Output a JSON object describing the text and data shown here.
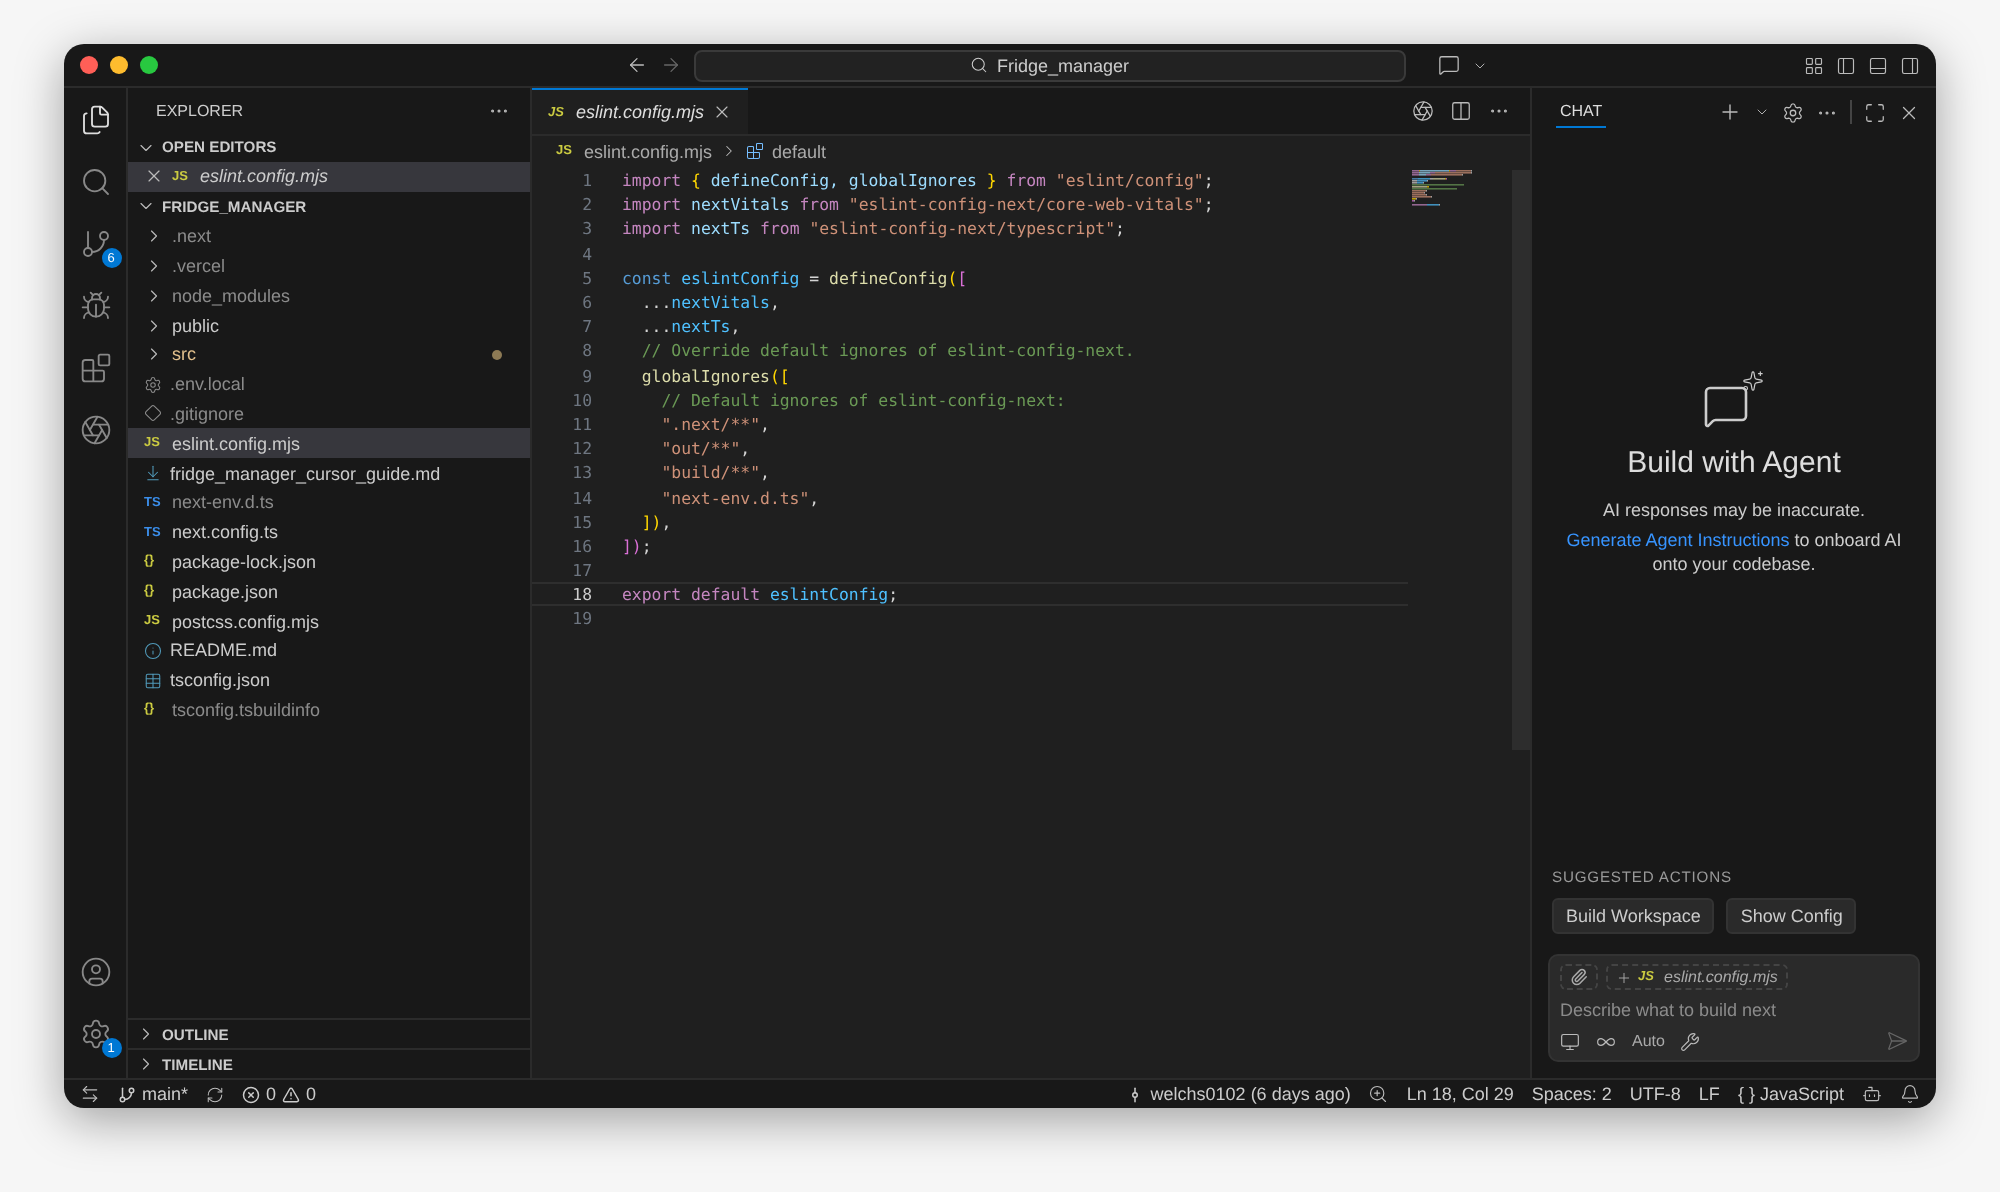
{
  "titlebar": {
    "search": "Fridge_manager"
  },
  "activity_bar": {
    "source_control_badge": "6",
    "settings_badge": "1"
  },
  "sidebar": {
    "title": "EXPLORER",
    "sections": [
      {
        "label": "OPEN EDITORS",
        "expanded": true,
        "items": [
          {
            "kind": "js",
            "label": "eslint.config.mjs",
            "badge": "JS",
            "selected": true
          }
        ]
      },
      {
        "label": "FRIDGE_MANAGER",
        "expanded": true,
        "items": [
          {
            "kind": "folder",
            "label": ".next",
            "expanded": false,
            "dimmed": true,
            "modified": false,
            "selected": false
          },
          {
            "kind": "folder",
            "label": ".vercel",
            "expanded": false,
            "dimmed": true,
            "modified": false,
            "selected": false
          },
          {
            "kind": "folder",
            "label": "node_modules",
            "expanded": false,
            "dimmed": true,
            "modified": false,
            "selected": false
          },
          {
            "kind": "folder",
            "label": "public",
            "expanded": false,
            "dimmed": false,
            "modified": false,
            "selected": false
          },
          {
            "kind": "folder",
            "label": "src",
            "expanded": false,
            "dimmed": false,
            "modified": true,
            "selected": false
          },
          {
            "kind": "env",
            "label": ".env.local",
            "dimmed": true,
            "modified": false,
            "selected": false
          },
          {
            "kind": "ignore",
            "label": ".gitignore",
            "dimmed": true,
            "modified": false,
            "selected": false
          },
          {
            "kind": "js",
            "badge": "JS",
            "label": "eslint.config.mjs",
            "dimmed": false,
            "modified": false,
            "selected": true
          },
          {
            "kind": "markdown",
            "label": "fridge_manager_cursor_guide.md",
            "dimmed": false,
            "modified": false,
            "selected": false
          },
          {
            "kind": "ts",
            "badge": "TS",
            "label": "next-env.d.ts",
            "dimmed": true,
            "modified": false,
            "selected": false
          },
          {
            "kind": "ts",
            "badge": "TS",
            "label": "next.config.ts",
            "dimmed": false,
            "modified": false,
            "selected": false
          },
          {
            "kind": "json",
            "badge": "{}",
            "label": "package-lock.json",
            "dimmed": false,
            "modified": false,
            "selected": false
          },
          {
            "kind": "json",
            "badge": "{}",
            "label": "package.json",
            "dimmed": false,
            "modified": false,
            "selected": false
          },
          {
            "kind": "js",
            "badge": "JS",
            "label": "postcss.config.mjs",
            "dimmed": false,
            "modified": false,
            "selected": false
          },
          {
            "kind": "readme",
            "label": "README.md",
            "dimmed": false,
            "modified": false,
            "selected": false
          },
          {
            "kind": "tsconfig",
            "label": "tsconfig.json",
            "dimmed": false,
            "modified": false,
            "selected": false
          },
          {
            "kind": "json",
            "badge": "{}",
            "label": "tsconfig.tsbuildinfo",
            "dimmed": true,
            "modified": false,
            "selected": false
          }
        ]
      }
    ],
    "bottom_sections": [
      {
        "label": "OUTLINE",
        "expanded": false
      },
      {
        "label": "TIMELINE",
        "expanded": false
      }
    ]
  },
  "editor": {
    "tabs": [
      {
        "badge": "JS",
        "label": "eslint.config.mjs",
        "selected": true
      }
    ],
    "breadcrumb": [
      {
        "badge": "JS",
        "label": "eslint.config.mjs"
      },
      {
        "label": "default"
      }
    ],
    "lines": [
      {
        "number": "1",
        "current": false,
        "tokens": [
          {
            "kind": "keyword",
            "text": "import "
          },
          {
            "kind": "bracket",
            "text": "{"
          },
          {
            "kind": "variable",
            "text": " defineConfig, globalIgnores "
          },
          {
            "kind": "bracket",
            "text": "}"
          },
          {
            "kind": "keyword",
            "text": " from "
          },
          {
            "kind": "string",
            "text": "\"eslint/config\""
          },
          {
            "kind": "punct",
            "text": ";"
          }
        ]
      },
      {
        "number": "2",
        "current": false,
        "tokens": [
          {
            "kind": "keyword",
            "text": "import "
          },
          {
            "kind": "variable",
            "text": "nextVitals "
          },
          {
            "kind": "keyword",
            "text": "from "
          },
          {
            "kind": "string",
            "text": "\"eslint-config-next/core-web-vitals\""
          },
          {
            "kind": "punct",
            "text": ";"
          }
        ]
      },
      {
        "number": "3",
        "current": false,
        "tokens": [
          {
            "kind": "keyword",
            "text": "import "
          },
          {
            "kind": "variable",
            "text": "nextTs "
          },
          {
            "kind": "keyword",
            "text": "from "
          },
          {
            "kind": "string",
            "text": "\"eslint-config-next/typescript\""
          },
          {
            "kind": "punct",
            "text": ";"
          }
        ]
      },
      {
        "number": "4",
        "current": false
      },
      {
        "number": "5",
        "current": false,
        "tokens": [
          {
            "kind": "declaration",
            "text": "const "
          },
          {
            "kind": "constant",
            "text": "eslintConfig"
          },
          {
            "kind": "punct",
            "text": " = "
          },
          {
            "kind": "function",
            "text": "defineConfig"
          },
          {
            "kind": "bracket",
            "text": "("
          },
          {
            "kind": "bracket2",
            "text": "["
          }
        ]
      },
      {
        "number": "6",
        "current": false,
        "tokens": [
          {
            "kind": "punct",
            "text": "  ..."
          },
          {
            "kind": "constant",
            "text": "nextVitals"
          },
          {
            "kind": "punct",
            "text": ","
          }
        ]
      },
      {
        "number": "7",
        "current": false,
        "tokens": [
          {
            "kind": "punct",
            "text": "  ..."
          },
          {
            "kind": "constant",
            "text": "nextTs"
          },
          {
            "kind": "punct",
            "text": ","
          }
        ]
      },
      {
        "number": "8",
        "current": false,
        "tokens": [
          {
            "kind": "comment",
            "text": "  // Override default ignores of eslint-config-next."
          }
        ]
      },
      {
        "number": "9",
        "current": false,
        "tokens": [
          {
            "kind": "function",
            "text": "  globalIgnores"
          },
          {
            "kind": "bracket",
            "text": "(["
          }
        ]
      },
      {
        "number": "10",
        "current": false,
        "tokens": [
          {
            "kind": "comment",
            "text": "    // Default ignores of eslint-config-next:"
          }
        ]
      },
      {
        "number": "11",
        "current": false,
        "tokens": [
          {
            "kind": "string",
            "text": "    \".next/**\""
          },
          {
            "kind": "punct",
            "text": ","
          }
        ]
      },
      {
        "number": "12",
        "current": false,
        "tokens": [
          {
            "kind": "string",
            "text": "    \"out/**\""
          },
          {
            "kind": "punct",
            "text": ","
          }
        ]
      },
      {
        "number": "13",
        "current": false,
        "tokens": [
          {
            "kind": "string",
            "text": "    \"build/**\""
          },
          {
            "kind": "punct",
            "text": ","
          }
        ]
      },
      {
        "number": "14",
        "current": false,
        "tokens": [
          {
            "kind": "string",
            "text": "    \"next-env.d.ts\""
          },
          {
            "kind": "punct",
            "text": ","
          }
        ]
      },
      {
        "number": "15",
        "current": false,
        "tokens": [
          {
            "kind": "bracket",
            "text": "  ])"
          },
          {
            "kind": "punct",
            "text": ","
          }
        ]
      },
      {
        "number": "16",
        "current": false,
        "tokens": [
          {
            "kind": "bracket2",
            "text": "])"
          },
          {
            "kind": "punct",
            "text": ";"
          }
        ]
      },
      {
        "number": "17",
        "current": false
      },
      {
        "number": "18",
        "current": true,
        "tokens": [
          {
            "kind": "keyword",
            "text": "export default "
          },
          {
            "kind": "constant",
            "text": "eslintConfig"
          },
          {
            "kind": "punct",
            "text": ";"
          }
        ]
      },
      {
        "number": "19",
        "current": false
      }
    ]
  },
  "chat": {
    "tabs": [
      {
        "label": "CHAT",
        "selected": true
      }
    ],
    "title": "Build with Agent",
    "disclaimer": "AI responses may be inaccurate.",
    "link": "Generate Agent Instructions",
    "after_link": " to onboard AI onto your codebase.",
    "suggested_title": "SUGGESTED ACTIONS",
    "suggestions": [
      "Build Workspace",
      "Show Config"
    ],
    "context_file": {
      "badge": "JS",
      "label": "eslint.config.mjs"
    },
    "placeholder": "Describe what to build next",
    "mode": "Auto"
  },
  "status_bar": {
    "branch": "main*",
    "errors": "0",
    "warnings": "0",
    "blame": "welchs0102 (6 days ago)",
    "position": "Ln 18, Col 29",
    "spaces": "Spaces: 2",
    "encoding": "UTF-8",
    "eol": "LF",
    "language_icon": "{ }",
    "language": "JavaScript"
  }
}
